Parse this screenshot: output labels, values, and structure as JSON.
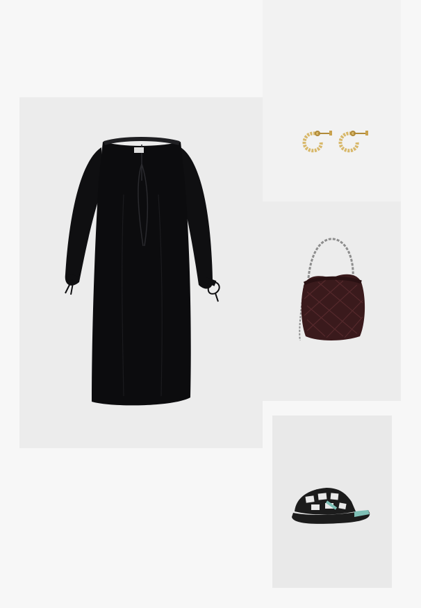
{
  "outfit": {
    "items": [
      {
        "id": "dress",
        "icon": "dress-icon",
        "color": "#0d0d0f"
      },
      {
        "id": "earrings",
        "icon": "hoop-earrings-icon",
        "color": "#d8b86a"
      },
      {
        "id": "bag",
        "icon": "quilted-bag-icon",
        "color": "#3a1a1c"
      },
      {
        "id": "shoes",
        "icon": "mule-shoe-icon",
        "color": "#1c1c1c",
        "accent": "#7fc0b6"
      }
    ]
  }
}
